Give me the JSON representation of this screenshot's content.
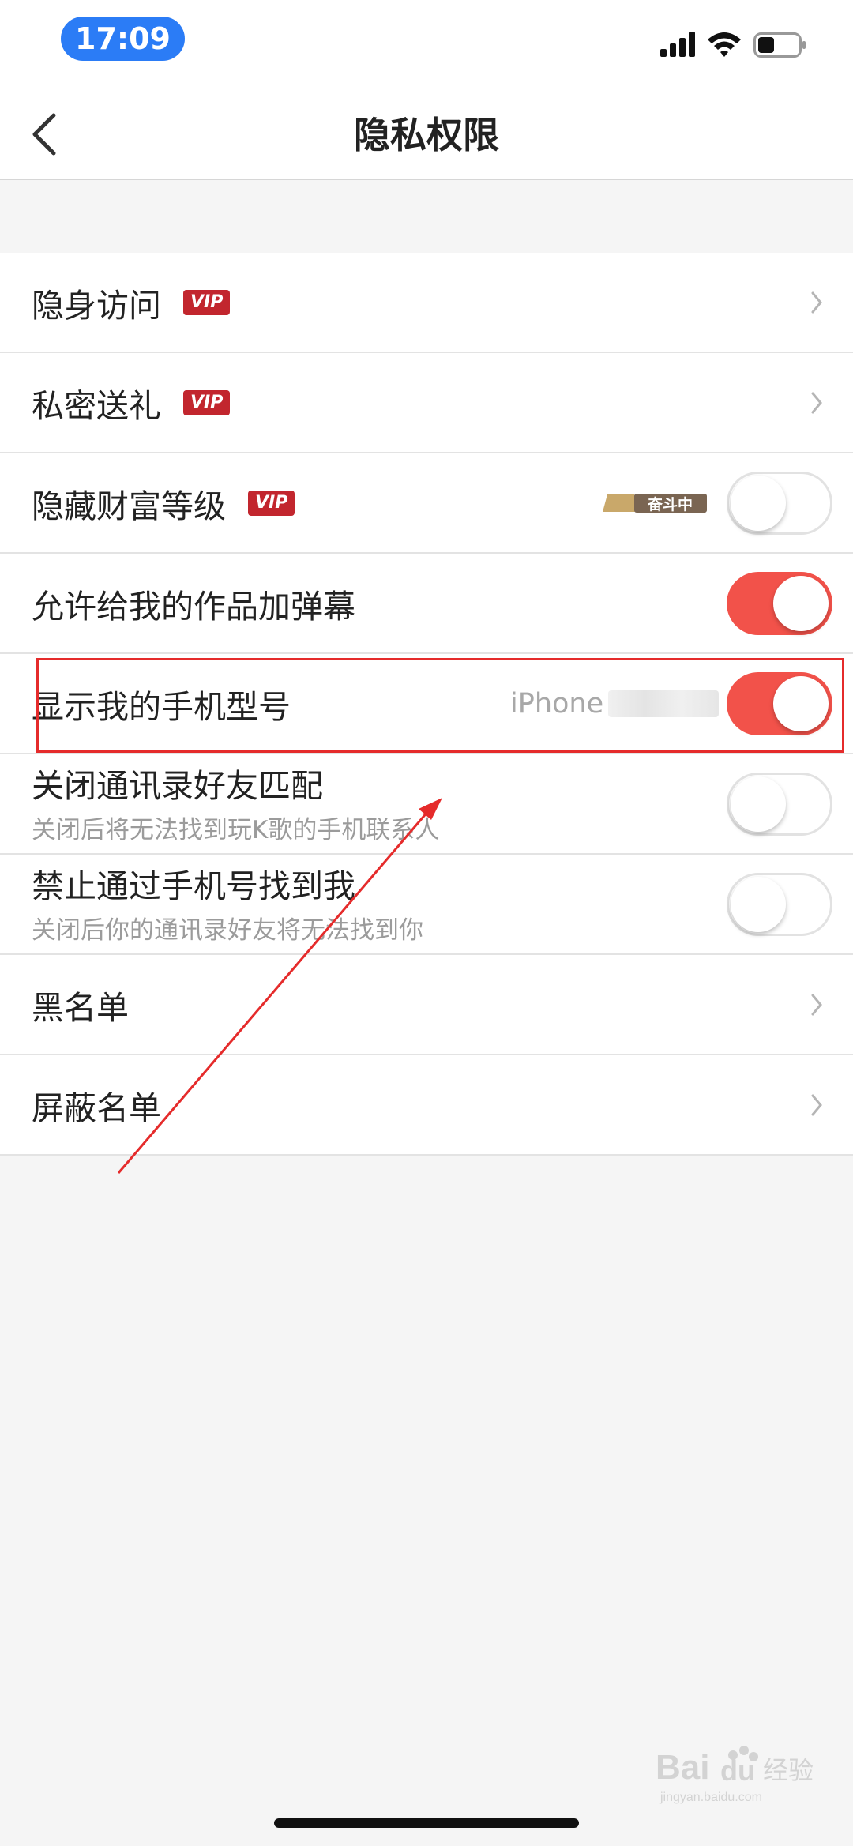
{
  "status_bar": {
    "time": "17:09"
  },
  "header": {
    "title": "隐私权限"
  },
  "rows": [
    {
      "label": "隐身访问",
      "badge": "VIP",
      "control": "chevron"
    },
    {
      "label": "私密送礼",
      "badge": "VIP",
      "control": "chevron"
    },
    {
      "label": "隐藏财富等级",
      "badge": "VIP",
      "rank_badge": "奋斗中",
      "control": "switch",
      "on": false
    },
    {
      "label": "允许给我的作品加弹幕",
      "control": "switch",
      "on": true
    },
    {
      "label": "显示我的手机型号",
      "value": "iPhone",
      "control": "switch",
      "on": true
    },
    {
      "label": "关闭通讯录好友匹配",
      "sub": "关闭后将无法找到玩K歌的手机联系人",
      "control": "switch",
      "on": false
    },
    {
      "label": "禁止通过手机号找到我",
      "sub": "关闭后你的通讯录好友将无法找到你",
      "control": "switch",
      "on": false
    },
    {
      "label": "黑名单",
      "control": "chevron"
    },
    {
      "label": "屏蔽名单",
      "control": "chevron"
    }
  ],
  "watermark": {
    "text": "Baidu经验",
    "subtext": "jingyan.baidu.com"
  },
  "colors": {
    "accent": "#f2524a",
    "vip": "#c2262e",
    "time_pill": "#2b7cf6",
    "annotation": "#e52b2b"
  }
}
